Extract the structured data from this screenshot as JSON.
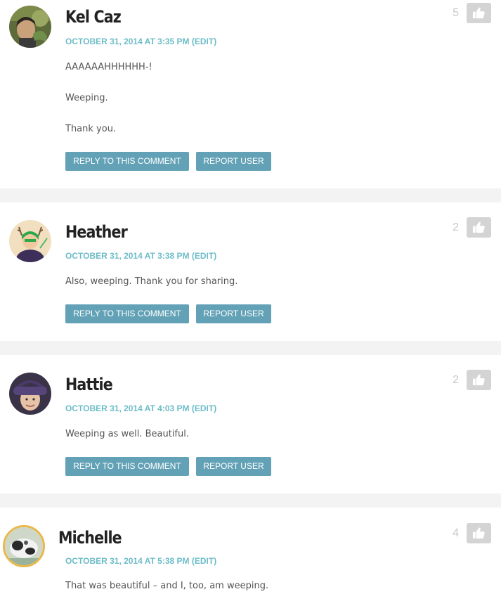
{
  "comments": [
    {
      "author": "Kel Caz",
      "date": "OCTOBER 31, 2014 AT 3:35 PM",
      "edit": "(EDIT)",
      "paragraphs": [
        "AAAAAAHHHHHH-!",
        "Weeping.",
        "Thank you."
      ],
      "likes": "5",
      "reply_label": "REPLY TO THIS COMMENT",
      "report_label": "REPORT USER",
      "avatar_icon": "user-photo-avatar"
    },
    {
      "author": "Heather",
      "date": "OCTOBER 31, 2014 AT 3:38 PM",
      "edit": "(EDIT)",
      "paragraphs": [
        "Also, weeping. Thank you for sharing."
      ],
      "likes": "2",
      "reply_label": "REPLY TO THIS COMMENT",
      "report_label": "REPORT USER",
      "avatar_icon": "cartoon-avatar"
    },
    {
      "author": "Hattie",
      "date": "OCTOBER 31, 2014 AT 4:03 PM",
      "edit": "(EDIT)",
      "paragraphs": [
        "Weeping as well. Beautiful."
      ],
      "likes": "2",
      "reply_label": "REPLY TO THIS COMMENT",
      "report_label": "REPORT USER",
      "avatar_icon": "user-photo-avatar"
    },
    {
      "author": "Michelle",
      "date": "OCTOBER 31, 2014 AT 5:38 PM",
      "edit": "(EDIT)",
      "paragraphs": [
        "That was beautiful – and I, too, am weeping."
      ],
      "likes": "4",
      "avatar_icon": "cat-photo-avatar"
    }
  ],
  "colors": {
    "accent": "#6dbcc8",
    "button": "#63a2b6",
    "like_button": "#d4d4d4",
    "avatar_border": "#e8b84a"
  },
  "icons": {
    "like": "thumbs-up-icon"
  }
}
